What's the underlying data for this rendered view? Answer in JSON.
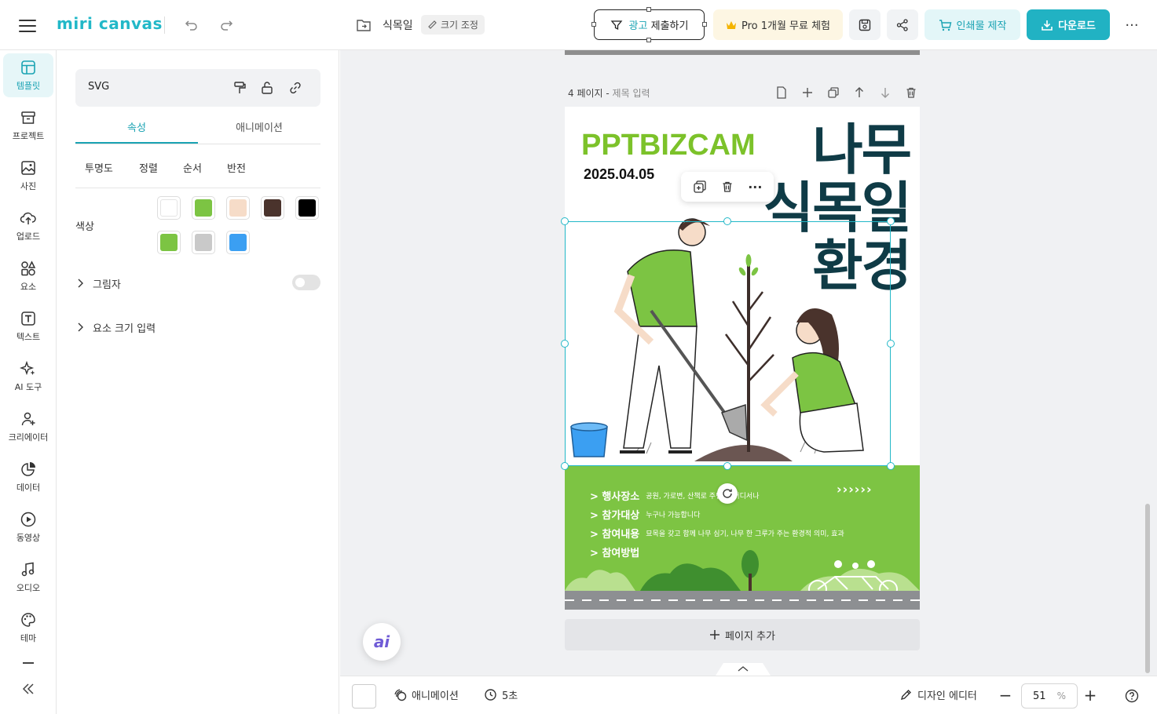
{
  "app": {
    "logo_text": "miri canvas",
    "accent": "#22b8c8"
  },
  "topbar": {
    "doc_title": "식목일",
    "resize_label": "크기 조정",
    "ad_label_prefix": "광고",
    "ad_label_suffix": "제출하기",
    "pro_label": "Pro 1개월 무료 체험",
    "print_label": "인쇄물 제작",
    "download_label": "다운로드"
  },
  "rail": {
    "items": [
      {
        "label": "템플릿",
        "icon": "template-icon"
      },
      {
        "label": "프로젝트",
        "icon": "archive-icon"
      },
      {
        "label": "사진",
        "icon": "image-icon"
      },
      {
        "label": "업로드",
        "icon": "cloud-upload-icon"
      },
      {
        "label": "요소",
        "icon": "shapes-icon"
      },
      {
        "label": "텍스트",
        "icon": "text-icon"
      },
      {
        "label": "AI 도구",
        "icon": "sparkle-icon"
      },
      {
        "label": "크리에이터",
        "icon": "creator-icon"
      },
      {
        "label": "데이터",
        "icon": "chart-icon"
      },
      {
        "label": "동영상",
        "icon": "play-icon"
      },
      {
        "label": "오디오",
        "icon": "music-icon"
      },
      {
        "label": "테마",
        "icon": "palette-icon"
      }
    ]
  },
  "panel": {
    "element_type": "SVG",
    "tabs": [
      "속성",
      "애니메이션"
    ],
    "subtabs": [
      "투명도",
      "정렬",
      "순서",
      "반전"
    ],
    "color_label": "색상",
    "colors": [
      "#ffffff",
      "#7cc443",
      "#f6dcc8",
      "#4a332c",
      "#000000",
      "#7cc443",
      "#c9c9c9",
      "#3b9ff2"
    ],
    "shadow_label": "그림자",
    "size_label": "요소 크기 입력"
  },
  "canvas": {
    "page_label": "4 페이지",
    "page_title_placeholder": "제목 입력",
    "brand_text": "PPTBIZCAM",
    "date_text": "2025.04.05",
    "title_lines": [
      "나무",
      "식목일",
      "환경"
    ],
    "info": [
      {
        "key": "> 행사장소",
        "value": "공원, 가로변, 산책로 주변 등 어디서나"
      },
      {
        "key": "> 참가대상",
        "value": "누구나 가능합니다"
      },
      {
        "key": "> 참여내용",
        "value": "묘목을 갖고 함께 나무 심기, 나무 한 그루가 주는 환경적 의미, 효과"
      },
      {
        "key": "> 참여방법",
        "value": ""
      }
    ],
    "arrows": "››››››",
    "add_page_label": "페이지 추가",
    "ai_label": "ai"
  },
  "bottombar": {
    "animation_label": "애니메이션",
    "duration_label": "5초",
    "design_editor_label": "디자인 에디터",
    "zoom_value": "51",
    "zoom_unit": "%"
  }
}
